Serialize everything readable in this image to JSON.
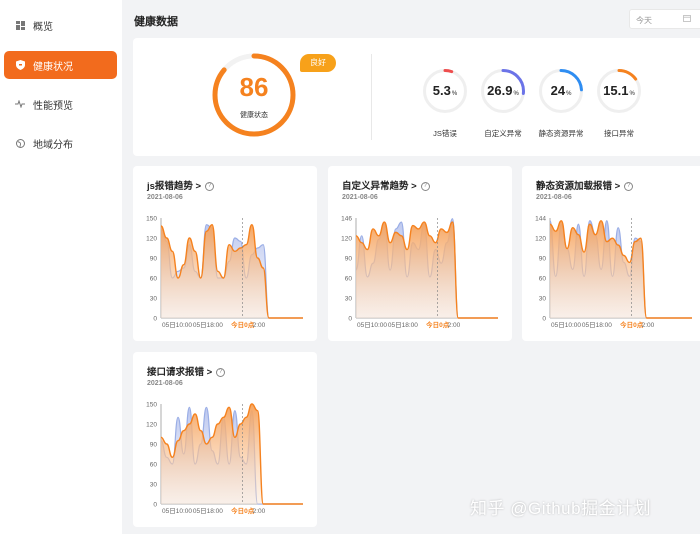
{
  "sidebar": {
    "items": [
      {
        "label": "概览",
        "icon": "dashboard-icon",
        "active": false
      },
      {
        "label": "健康状况",
        "icon": "shield-icon",
        "active": true
      },
      {
        "label": "性能预览",
        "icon": "pulse-icon",
        "active": false
      },
      {
        "label": "地域分布",
        "icon": "globe-icon",
        "active": false
      }
    ]
  },
  "header": {
    "title": "健康数据",
    "date_value": "今天",
    "date_icon": "calendar-icon"
  },
  "health": {
    "score": "86",
    "score_fraction": 0.86,
    "score_label": "健康状态",
    "badge": "良好",
    "metrics": [
      {
        "value": "5.3",
        "unit": "%",
        "label": "JS错误",
        "fraction": 0.053,
        "color": "#ee4d4d"
      },
      {
        "value": "26.9",
        "unit": "%",
        "label": "自定义异常",
        "fraction": 0.269,
        "color": "#6b73e8"
      },
      {
        "value": "24",
        "unit": "%",
        "label": "静态资源异常",
        "fraction": 0.24,
        "color": "#2e8df2"
      },
      {
        "value": "15.1",
        "unit": "%",
        "label": "接口异常",
        "fraction": 0.151,
        "color": "#f5821f"
      }
    ]
  },
  "colors": {
    "accent": "#f26b1d",
    "orange": "#f5821f",
    "blue_series": "#9aaee6"
  },
  "chart_data": [
    {
      "type": "area",
      "title": "js报错趋势 >",
      "date": "2021-08-06",
      "y_ticks": [
        "150",
        "120",
        "90",
        "60",
        "30",
        "0"
      ],
      "ylim": [
        0,
        150
      ],
      "x_ticks": [
        "05日10:00",
        "05日18:00",
        "今日0点",
        "2:00"
      ],
      "marker_label": "今日0点",
      "series": [
        {
          "values": [
            138,
            120,
            100,
            60,
            80,
            120,
            100,
            60,
            130,
            140,
            70,
            60,
            110,
            100,
            105,
            110,
            140,
            90,
            75,
            0,
            0,
            0,
            0,
            0,
            0,
            0
          ]
        },
        {
          "values": [
            136,
            115,
            60,
            70,
            75,
            110,
            70,
            60,
            140,
            135,
            60,
            60,
            85,
            120,
            115,
            60,
            95,
            105,
            110,
            0,
            0,
            0,
            0,
            0,
            0,
            0
          ]
        }
      ]
    },
    {
      "type": "area",
      "title": "自定义异常趋势 >",
      "date": "2021-08-06",
      "y_ticks": [
        "146",
        "120",
        "90",
        "60",
        "30",
        "0"
      ],
      "ylim": [
        0,
        146
      ],
      "x_ticks": [
        "05日10:00",
        "05日18:00",
        "今日0点",
        "2:00"
      ],
      "marker_label": "今日0点",
      "series": [
        {
          "values": [
            120,
            110,
            100,
            130,
            120,
            140,
            110,
            125,
            120,
            100,
            135,
            130,
            140,
            120,
            110,
            130,
            125,
            140,
            0,
            0,
            0,
            0,
            0,
            0,
            0,
            0
          ]
        },
        {
          "values": [
            70,
            120,
            60,
            80,
            115,
            140,
            70,
            130,
            140,
            60,
            110,
            100,
            140,
            60,
            100,
            80,
            110,
            145,
            0,
            0,
            0,
            0,
            0,
            0,
            0,
            0
          ]
        }
      ]
    },
    {
      "type": "area",
      "title": "静态资源加载报错 >",
      "date": "2021-08-06",
      "y_ticks": [
        "144",
        "120",
        "90",
        "60",
        "30",
        "0"
      ],
      "ylim": [
        0,
        144
      ],
      "x_ticks": [
        "05日10:00",
        "05日18:00",
        "今日0点",
        "2:00"
      ],
      "marker_label": "今日0点",
      "series": [
        {
          "values": [
            135,
            125,
            140,
            100,
            130,
            120,
            95,
            135,
            120,
            140,
            110,
            115,
            105,
            90,
            80,
            110,
            115,
            0,
            0,
            0,
            0,
            0,
            0,
            0,
            0,
            0
          ]
        },
        {
          "values": [
            140,
            60,
            135,
            100,
            70,
            135,
            60,
            140,
            120,
            70,
            140,
            60,
            130,
            80,
            60,
            115,
            110,
            0,
            0,
            0,
            0,
            0,
            0,
            0,
            0,
            0
          ]
        }
      ]
    },
    {
      "type": "area",
      "title": "接口请求报错 >",
      "date": "2021-08-06",
      "y_ticks": [
        "150",
        "120",
        "90",
        "60",
        "30",
        "0"
      ],
      "ylim": [
        0,
        150
      ],
      "x_ticks": [
        "05日10:00",
        "05日18:00",
        "今日0点",
        "2:00"
      ],
      "marker_label": "今日0点",
      "series": [
        {
          "values": [
            100,
            90,
            70,
            95,
            110,
            120,
            135,
            110,
            90,
            100,
            120,
            130,
            145,
            100,
            120,
            130,
            150,
            140,
            0,
            0,
            0,
            0,
            0,
            0,
            0,
            0
          ]
        },
        {
          "values": [
            95,
            70,
            60,
            130,
            75,
            145,
            60,
            90,
            145,
            80,
            60,
            130,
            60,
            140,
            70,
            60,
            140,
            0,
            0,
            0,
            0,
            0,
            0,
            0,
            0,
            0
          ]
        }
      ]
    }
  ],
  "watermark": "知乎 @Github掘金计划"
}
